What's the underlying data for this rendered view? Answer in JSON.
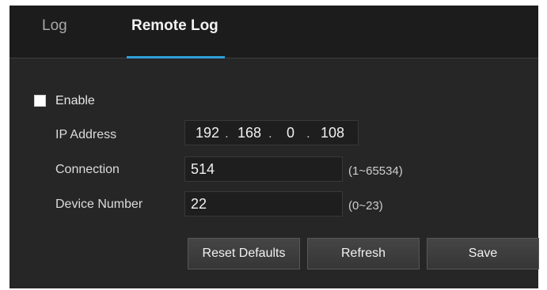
{
  "tabs": [
    {
      "label": "Log",
      "active": false
    },
    {
      "label": "Remote Log",
      "active": true
    }
  ],
  "colors": {
    "panel_background": "#262626",
    "tab_indicator": "#2f9fd8",
    "active_tab_text": "#f2f2f2",
    "inactive_tab_text": "#a8a8a8"
  },
  "form": {
    "enable": {
      "label": "Enable",
      "checked": false
    },
    "ip_address": {
      "label": "IP Address",
      "octets": [
        "192",
        "168",
        "0",
        "108"
      ],
      "separator": "."
    },
    "connection": {
      "label": "Connection",
      "value": "514",
      "range": "(1~65534)"
    },
    "device_number": {
      "label": "Device Number",
      "value": "22",
      "range": "(0~23)"
    }
  },
  "buttons": {
    "reset_defaults": "Reset Defaults",
    "refresh": "Refresh",
    "save": "Save"
  }
}
